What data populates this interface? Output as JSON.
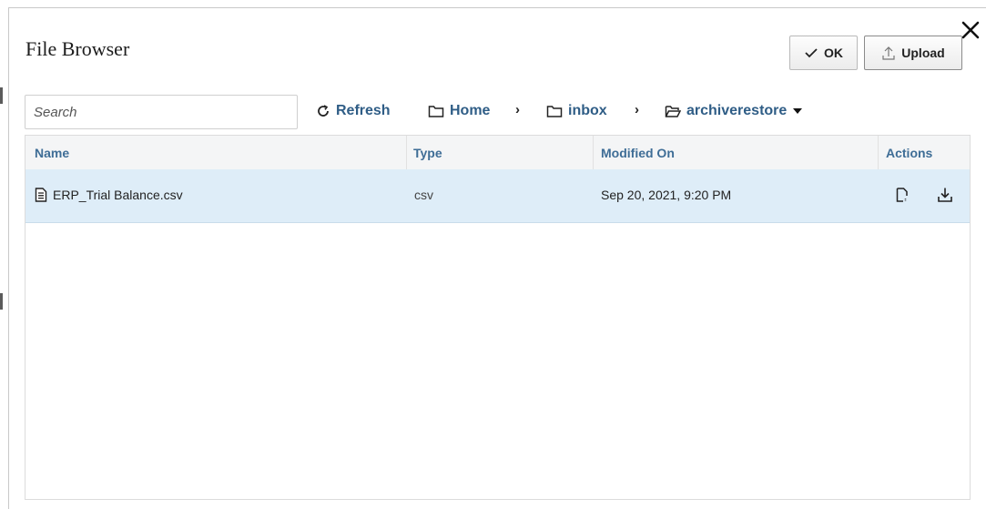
{
  "dialog": {
    "title": "File Browser",
    "close_icon": "close-icon",
    "buttons": {
      "ok_label": "OK",
      "ok_icon": "checkmark-icon",
      "upload_label": "Upload",
      "upload_icon": "upload-icon"
    }
  },
  "toolbar": {
    "search_placeholder": "Search",
    "refresh_label": "Refresh",
    "refresh_icon": "refresh-icon"
  },
  "breadcrumb": {
    "items": [
      {
        "label": "Home",
        "icon": "folder-icon"
      },
      {
        "label": "inbox",
        "icon": "folder-icon"
      },
      {
        "label": "archiverestore",
        "icon": "folder-open-icon",
        "dropdown_icon": "caret-down-icon"
      }
    ],
    "separator_icon": "chevron-right-icon"
  },
  "table": {
    "columns": [
      "Name",
      "Type",
      "Modified On",
      "Actions"
    ],
    "rows": [
      {
        "name": "ERP_Trial Balance.csv",
        "name_icon": "file-icon",
        "type": "csv",
        "modified": "Sep 20, 2021, 9:20 PM",
        "actions": [
          "view-file-icon",
          "download-icon"
        ]
      }
    ],
    "selected_row_color": "#deedf8"
  },
  "colors": {
    "link": "#2f5d86",
    "header_text": "#3e6d96",
    "header_bg": "#f4f5f6"
  }
}
